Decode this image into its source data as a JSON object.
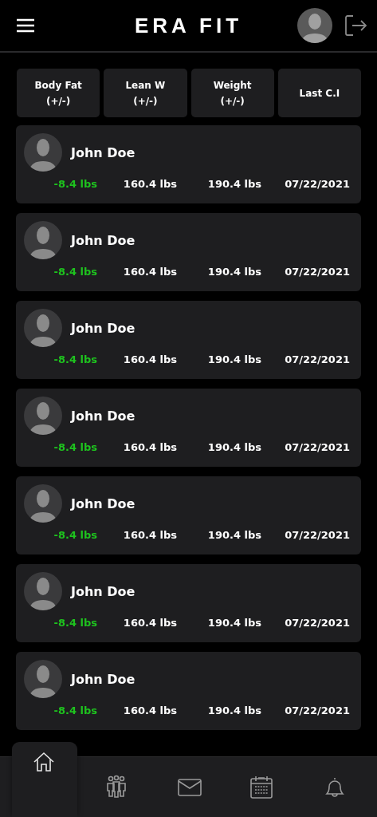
{
  "header": {
    "logo": "ERA FIT"
  },
  "columns": [
    {
      "label": "Body Fat\n(+/-)"
    },
    {
      "label": "Lean W\n(+/-)"
    },
    {
      "label": "Weight\n(+/-)"
    },
    {
      "label": "Last C.I"
    }
  ],
  "clients": [
    {
      "name": "John Doe",
      "body_fat": "-8.4 lbs",
      "lean_weight": "160.4 lbs",
      "weight": "190.4 lbs",
      "last_check_in": "07/22/2021"
    },
    {
      "name": "John Doe",
      "body_fat": "-8.4 lbs",
      "lean_weight": "160.4 lbs",
      "weight": "190.4 lbs",
      "last_check_in": "07/22/2021"
    },
    {
      "name": "John Doe",
      "body_fat": "-8.4 lbs",
      "lean_weight": "160.4 lbs",
      "weight": "190.4 lbs",
      "last_check_in": "07/22/2021"
    },
    {
      "name": "John Doe",
      "body_fat": "-8.4 lbs",
      "lean_weight": "160.4 lbs",
      "weight": "190.4 lbs",
      "last_check_in": "07/22/2021"
    },
    {
      "name": "John Doe",
      "body_fat": "-8.4 lbs",
      "lean_weight": "160.4 lbs",
      "weight": "190.4 lbs",
      "last_check_in": "07/22/2021"
    },
    {
      "name": "John Doe",
      "body_fat": "-8.4 lbs",
      "lean_weight": "160.4 lbs",
      "weight": "190.4 lbs",
      "last_check_in": "07/22/2021"
    },
    {
      "name": "John Doe",
      "body_fat": "-8.4 lbs",
      "lean_weight": "160.4 lbs",
      "weight": "190.4 lbs",
      "last_check_in": "07/22/2021"
    }
  ],
  "nav": [
    {
      "kind": "home",
      "selected": true
    },
    {
      "kind": "group",
      "selected": false
    },
    {
      "kind": "mail",
      "selected": false
    },
    {
      "kind": "calendar",
      "selected": false
    },
    {
      "kind": "bell",
      "selected": false
    }
  ]
}
